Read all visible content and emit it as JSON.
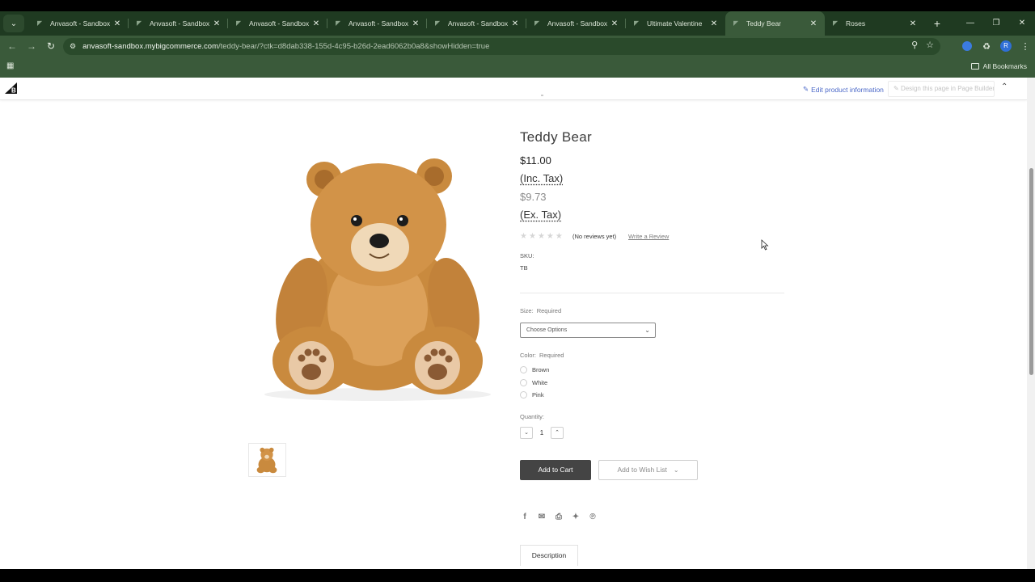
{
  "browser": {
    "tabs": [
      {
        "label": "Anvasoft - Sandbox B",
        "active": false
      },
      {
        "label": "Anvasoft - Sandbox B",
        "active": false
      },
      {
        "label": "Anvasoft - Sandbox B",
        "active": false
      },
      {
        "label": "Anvasoft - Sandbox B",
        "active": false
      },
      {
        "label": "Anvasoft - Sandbox B",
        "active": false
      },
      {
        "label": "Anvasoft - Sandbox B",
        "active": false
      },
      {
        "label": "Ultimate Valentine",
        "active": false
      },
      {
        "label": "Teddy Bear",
        "active": true
      },
      {
        "label": "Roses",
        "active": false
      }
    ],
    "url_host": "anvasoft-sandbox.mybigcommerce.com",
    "url_path": "/teddy-bear/?ctk=d8dab338-155d-4c95-b26d-2ead6062b0a8&showHidden=true",
    "bookmarks_label": "All Bookmarks",
    "profile_initial": "R"
  },
  "bc_toolbar": {
    "edit_label": "Edit product information",
    "design_label": "Design this page in Page Builder"
  },
  "product": {
    "title": "Teddy Bear",
    "price_inc": "$11.00",
    "inc_tax_label": "(Inc. Tax)",
    "price_ex": "$9.73",
    "ex_tax_label": "(Ex. Tax)",
    "reviews_text": "(No reviews yet)",
    "write_review": "Write a Review",
    "sku_label": "SKU:",
    "sku_value": "TB",
    "size_label": "Size:",
    "size_required": "Required",
    "size_placeholder": "Choose Options",
    "color_label": "Color:",
    "color_required": "Required",
    "colors": [
      "Brown",
      "White",
      "Pink"
    ],
    "quantity_label": "Quantity:",
    "quantity": "1",
    "add_to_cart": "Add to Cart",
    "wishlist": "Add to Wish List",
    "description_tab": "Description"
  },
  "colors": {
    "tab_bg": "#1f3a21",
    "toolbar_bg": "#3a5a3a",
    "cart_button": "#444444",
    "link_blue": "#4b68c8"
  },
  "icons": {
    "share": [
      "facebook-icon",
      "email-icon",
      "print-icon",
      "twitter-icon",
      "pinterest-icon"
    ]
  }
}
